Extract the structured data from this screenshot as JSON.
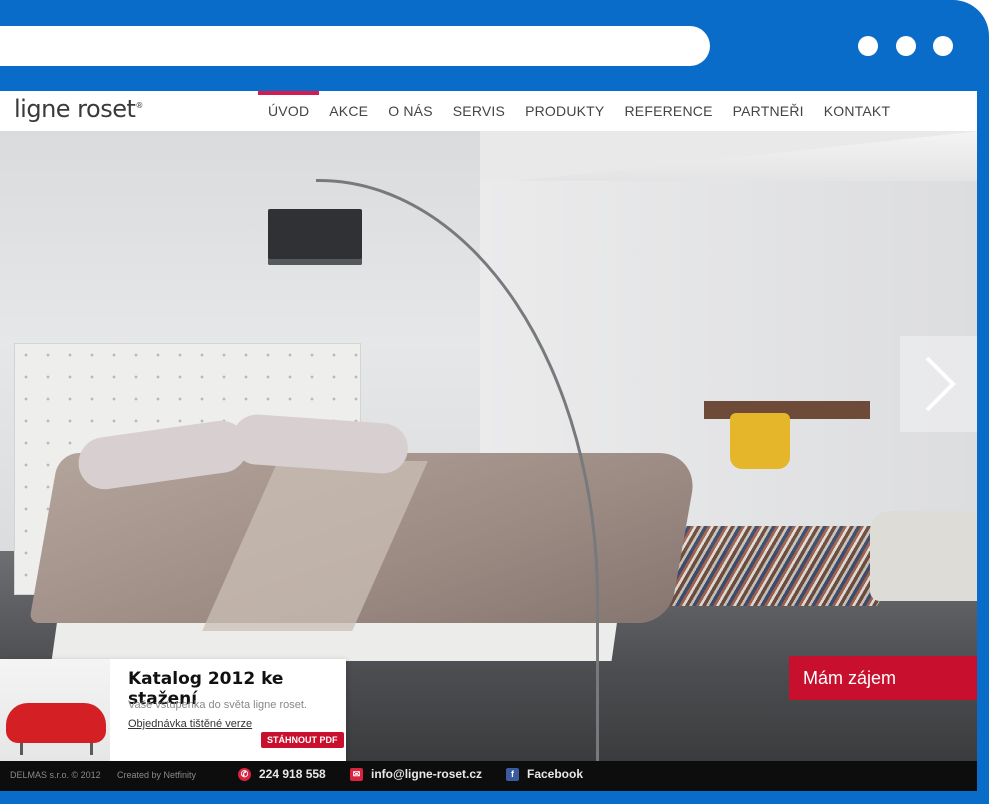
{
  "browser": {
    "url": "",
    "window_controls": [
      "dot",
      "dot",
      "dot"
    ]
  },
  "site": {
    "logo_text": "ligne roset",
    "logo_mark": "®"
  },
  "nav": {
    "items": [
      {
        "label": "ÚVOD",
        "active": true
      },
      {
        "label": "AKCE",
        "active": false
      },
      {
        "label": "O NÁS",
        "active": false
      },
      {
        "label": "SERVIS",
        "active": false
      },
      {
        "label": "PRODUKTY",
        "active": false
      },
      {
        "label": "REFERENCE",
        "active": false
      },
      {
        "label": "PARTNEŘI",
        "active": false
      },
      {
        "label": "KONTAKT",
        "active": false
      }
    ]
  },
  "hero": {
    "next_icon": "chevron-right-icon"
  },
  "catalog": {
    "title": "Katalog 2012 ke stažení",
    "subtitle": "Vaše vstupenka do světa ligne roset.",
    "order_link": "Objednávka tištěné verze",
    "download_button": "STÁHNOUT PDF"
  },
  "footer": {
    "copyright": "DELMAS s.r.o. © 2012",
    "created_by": "Created by Netfinity",
    "phone": "224 918 558",
    "email": "info@ligne-roset.cz",
    "facebook": "Facebook",
    "cta": "Mám zájem"
  },
  "colors": {
    "frame": "#0a6cc9",
    "accent": "#c8102e",
    "footer_bg": "#0d0d0e"
  }
}
